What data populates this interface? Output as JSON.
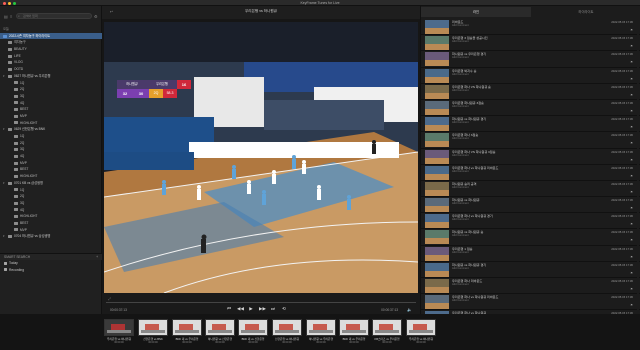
{
  "app": {
    "title": "KeyFrame Tunes for Live",
    "window_buttons": {
      "close_color": "#ff5f57",
      "min_color": "#febc2e",
      "max_color": "#28c840"
    }
  },
  "sidebar": {
    "search_placeholder": "검색어 입력",
    "section_label": "오늘",
    "items": [
      {
        "label": "2022시즌 여자농구 하이라이트",
        "level": 0,
        "selected": true,
        "icon": "folder-icon"
      },
      {
        "label": "여자농구",
        "level": 1,
        "icon": "folder-icon"
      },
      {
        "label": "BEAUTY",
        "level": 1,
        "icon": "folder-icon"
      },
      {
        "label": "LIFE",
        "level": 1,
        "icon": "folder-icon"
      },
      {
        "label": "VLOG",
        "level": 1,
        "icon": "folder-icon"
      },
      {
        "label": "OOTD",
        "level": 1,
        "icon": "folder-icon"
      },
      {
        "label": "0627 하나원큐 vs 우리은행",
        "level": 0,
        "group": true,
        "icon": "folder-icon"
      },
      {
        "label": "1Q",
        "level": 2,
        "icon": "folder-icon"
      },
      {
        "label": "2Q",
        "level": 2,
        "icon": "folder-icon"
      },
      {
        "label": "3Q",
        "level": 2,
        "icon": "folder-icon"
      },
      {
        "label": "4Q",
        "level": 2,
        "icon": "folder-icon"
      },
      {
        "label": "BEST",
        "level": 2,
        "icon": "folder-icon"
      },
      {
        "label": "MVP",
        "level": 2,
        "icon": "folder-icon"
      },
      {
        "label": "HIGHLIGHT",
        "level": 2,
        "icon": "folder-icon"
      },
      {
        "label": "0629 신한은행 vs BNK",
        "level": 0,
        "group": true,
        "icon": "folder-icon"
      },
      {
        "label": "1Q",
        "level": 2,
        "icon": "folder-icon"
      },
      {
        "label": "2Q",
        "level": 2,
        "icon": "folder-icon"
      },
      {
        "label": "3Q",
        "level": 2,
        "icon": "folder-icon"
      },
      {
        "label": "4Q",
        "level": 2,
        "icon": "folder-icon"
      },
      {
        "label": "MVP",
        "level": 2,
        "icon": "folder-icon"
      },
      {
        "label": "BEST",
        "level": 2,
        "icon": "folder-icon"
      },
      {
        "label": "HIGHLIGHT",
        "level": 2,
        "icon": "folder-icon"
      },
      {
        "label": "0701 KB vs 삼성생명",
        "level": 0,
        "group": true,
        "icon": "folder-icon"
      },
      {
        "label": "1Q",
        "level": 2,
        "icon": "folder-icon"
      },
      {
        "label": "2Q",
        "level": 2,
        "icon": "folder-icon"
      },
      {
        "label": "3Q",
        "level": 2,
        "icon": "folder-icon"
      },
      {
        "label": "4Q",
        "level": 2,
        "icon": "folder-icon"
      },
      {
        "label": "HIGHLIGHT",
        "level": 2,
        "icon": "folder-icon"
      },
      {
        "label": "BEST",
        "level": 2,
        "icon": "folder-icon"
      },
      {
        "label": "MVP",
        "level": 2,
        "icon": "folder-icon"
      },
      {
        "label": "0704 하나원큐 vs 삼성생명",
        "level": 0,
        "group": true,
        "icon": "folder-icon"
      }
    ],
    "smart_search": {
      "header": "SMART SEARCH",
      "items": [
        "Today",
        "Recording"
      ]
    }
  },
  "player": {
    "title": "우리은행 vs 하나원큐",
    "time_current": "00:00:37:13",
    "time_total": "00:00:37:13",
    "progress": 0.0,
    "scoreboard": {
      "home": "하나원큐",
      "away": "우리은행",
      "home_score": "32",
      "away_score": "30",
      "quarter": "2Q",
      "clock": "16",
      "shot": "58.3"
    },
    "buttons": [
      "skip-back",
      "step-back",
      "play",
      "step-forward",
      "skip-forward",
      "loop"
    ]
  },
  "right_panel": {
    "tabs": [
      "라인",
      "하이라이트"
    ],
    "active_tab": 0,
    "clips": [
      {
        "title": "리바운드",
        "sub": "Add Comment",
        "date": "2022.05.15 17:36"
      },
      {
        "title": "우리은행 3 점슛을 성공시킨",
        "sub": "Add Comment",
        "date": "2022.05.15 17:36"
      },
      {
        "title": "하나원큐 vs 우리은행 경기",
        "sub": "Add Comment",
        "date": "2022.05.15 17:36"
      },
      {
        "title": "우리은행 박지수 슛",
        "sub": "Add Comment",
        "date": "2022.05.15 17:36"
      },
      {
        "title": "우리은행 하나 VS 하나원큐 슛",
        "sub": "Add Comment",
        "date": "2022.05.15 17:36"
      },
      {
        "title": "우리은행 하나원큐 3점슛",
        "sub": "Add Comment",
        "date": "2022.05.15 17:36"
      },
      {
        "title": "하나원큐 vs 하나원큐 경기",
        "sub": "Add Comment",
        "date": "2022.05.15 17:36"
      },
      {
        "title": "우리은행 하나 3점슛",
        "sub": "Add Comment",
        "date": "2022.05.15 17:36"
      },
      {
        "title": "우리은행 하나 VS 하나원큐 3점슛",
        "sub": "Add Comment",
        "date": "2022.05.15 17:36"
      },
      {
        "title": "우리은행 하나 vs 하나원큐 리바운드",
        "sub": "Add Comment",
        "date": "2022.05.15 17:36"
      },
      {
        "title": "하나원큐 승리 공격",
        "sub": "Add Comment",
        "date": "2022.05.15 17:36"
      },
      {
        "title": "하나원큐 vs 하나원큐",
        "sub": "Add Comment",
        "date": "2022.05.15 17:36"
      },
      {
        "title": "우리은행 하나 vs 하나원큐 경기",
        "sub": "Add Comment",
        "date": "2022.05.15 17:36"
      },
      {
        "title": "하나원큐 vs 하나원큐 슛",
        "sub": "Add Comment",
        "date": "2022.05.15 17:36"
      },
      {
        "title": "우리은행 1 점슛",
        "sub": "Add Comment",
        "date": "2022.05.15 17:36"
      },
      {
        "title": "하나원큐 vs 하나원큐 경기",
        "sub": "Add Comment",
        "date": "2022.05.15 17:36"
      },
      {
        "title": "우리은행 하나 리바운드",
        "sub": "Add Comment",
        "date": "2022.05.15 17:36"
      },
      {
        "title": "우리은행 하나 vs 하나원큐 리바운드",
        "sub": "Add Comment",
        "date": "2022.05.15 17:36"
      },
      {
        "title": "우리은행 하나 vs 하나원큐",
        "sub": "Add Comment",
        "date": "2022.05.15 17:36"
      }
    ]
  },
  "filmstrip": {
    "thumbs": [
      {
        "title": "우리은행 vs 하나원큐",
        "time": "00:00:00"
      },
      {
        "title": "신한은행 vs BNK",
        "time": "00:00:00"
      },
      {
        "title": "BNK 대 vs 우리은행",
        "time": "00:00:00"
      },
      {
        "title": "하나원큐 vs 신한은행",
        "time": "00:00:00"
      },
      {
        "title": "BNK 대 vs 신한은행",
        "time": "00:00:00"
      },
      {
        "title": "신한은행 vs 하나원큐",
        "time": "00:00:00"
      },
      {
        "title": "하나원큐 vs 우리은행",
        "time": "00:00:00"
      },
      {
        "title": "BNK 대 vs 우리은행",
        "time": "00:00:00"
      },
      {
        "title": "KB스타즈 vs 우리은행",
        "time": "00:00:00"
      },
      {
        "title": "우리은행 vs 하나원큐",
        "time": "00:00:00"
      }
    ]
  },
  "colors": {
    "accent": "#3a5e8a",
    "scoreboard_home": "#e6a02b",
    "scoreboard_away": "#7b3fb0",
    "scoreboard_red": "#d0283a",
    "court_wood": "#c99a64"
  }
}
